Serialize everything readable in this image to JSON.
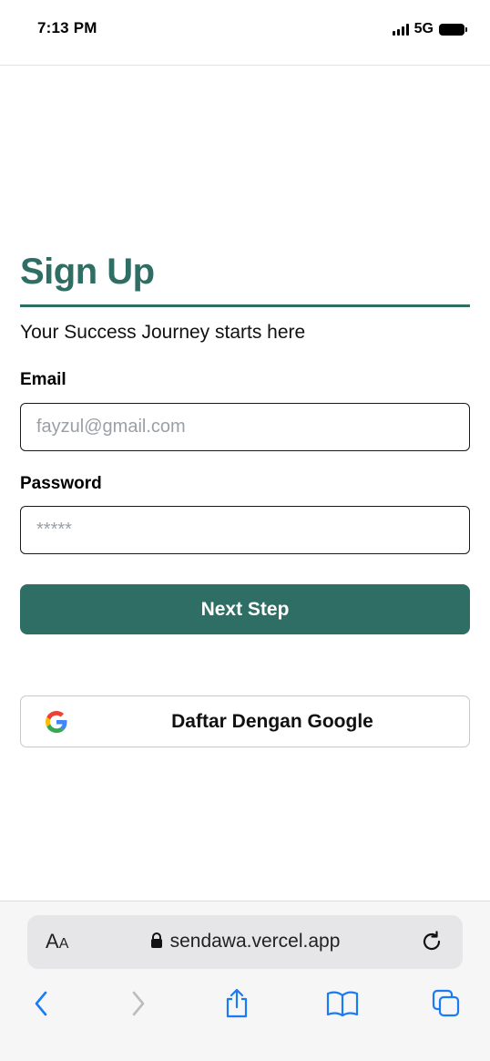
{
  "status_bar": {
    "time": "7:13 PM",
    "network": "5G"
  },
  "signup": {
    "title": "Sign Up",
    "subtitle": "Your Success Journey starts here",
    "email_label": "Email",
    "email_placeholder": "fayzul@gmail.com",
    "email_value": "",
    "password_label": "Password",
    "password_placeholder": "*****",
    "password_value": "",
    "next_button_label": "Next Step",
    "google_button_label": "Daftar Dengan Google"
  },
  "browser": {
    "text_size_button": "AA",
    "url": "sendawa.vercel.app",
    "icons": [
      "lock-icon",
      "reload-icon",
      "back-icon",
      "forward-icon",
      "share-icon",
      "bookmarks-icon",
      "tabs-icon"
    ]
  },
  "colors": {
    "brand": "#2f6e64",
    "ios_blue": "#1a7cf5"
  }
}
